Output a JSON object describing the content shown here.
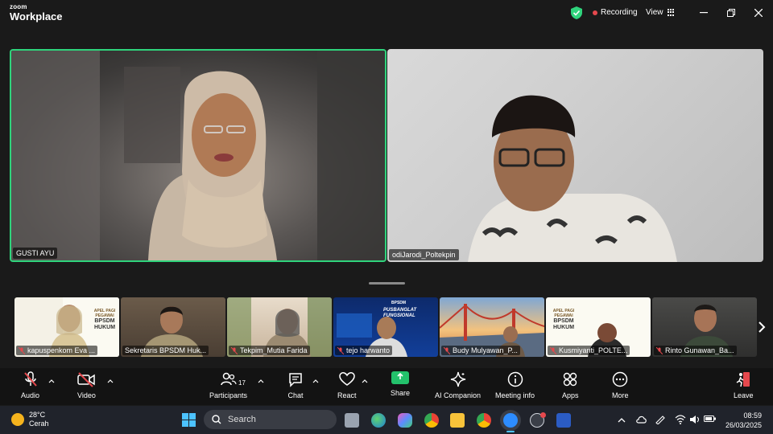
{
  "app": {
    "brand_top": "zoom",
    "brand_bottom": "Workplace"
  },
  "header": {
    "recording_label": "Recording",
    "view_label": "View"
  },
  "main_videos": [
    {
      "name": "GUSTI AYU"
    },
    {
      "name": "odiJarodi_Poltekpin"
    }
  ],
  "thumbnails": [
    {
      "name": "kapuspenkom Eva ...",
      "muted": true
    },
    {
      "name": "Sekretaris BPSDM Huk...",
      "muted": false
    },
    {
      "name": "Tekpim_Mutia Farida",
      "muted": true
    },
    {
      "name": "tejo harwanto",
      "muted": true
    },
    {
      "name": "Budy Mulyawan_P...",
      "muted": true
    },
    {
      "name": "Kusmiyanti_POLTE...",
      "muted": true
    },
    {
      "name": "Rinto Gunawan_Ba...",
      "muted": true
    }
  ],
  "thumbnail_poster_text": {
    "line1": "APEL PAGI",
    "line2": "PEGAWAI",
    "line3": "BPSDM",
    "line4": "HUKUM"
  },
  "thumbnail_banner_text": {
    "line1": "PUSBANGLAT",
    "line2": "FUNGSIONAL",
    "top": "BPSDM"
  },
  "toolbar": {
    "audio": "Audio",
    "video": "Video",
    "participants": "Participants",
    "participants_count": "17",
    "chat": "Chat",
    "react": "React",
    "share": "Share",
    "ai_companion": "AI Companion",
    "meeting_info": "Meeting info",
    "apps": "Apps",
    "more": "More",
    "leave": "Leave"
  },
  "taskbar": {
    "weather_temp": "28°C",
    "weather_desc": "Cerah",
    "search_label": "Search",
    "time": "08:59",
    "date": "26/03/2025"
  },
  "colors": {
    "active_speaker_border": "#2fd47c",
    "share_green": "#23c16b",
    "recording_red": "#e5484d",
    "toolbar_bg": "#131313",
    "taskbar_bg": "#20232b"
  }
}
